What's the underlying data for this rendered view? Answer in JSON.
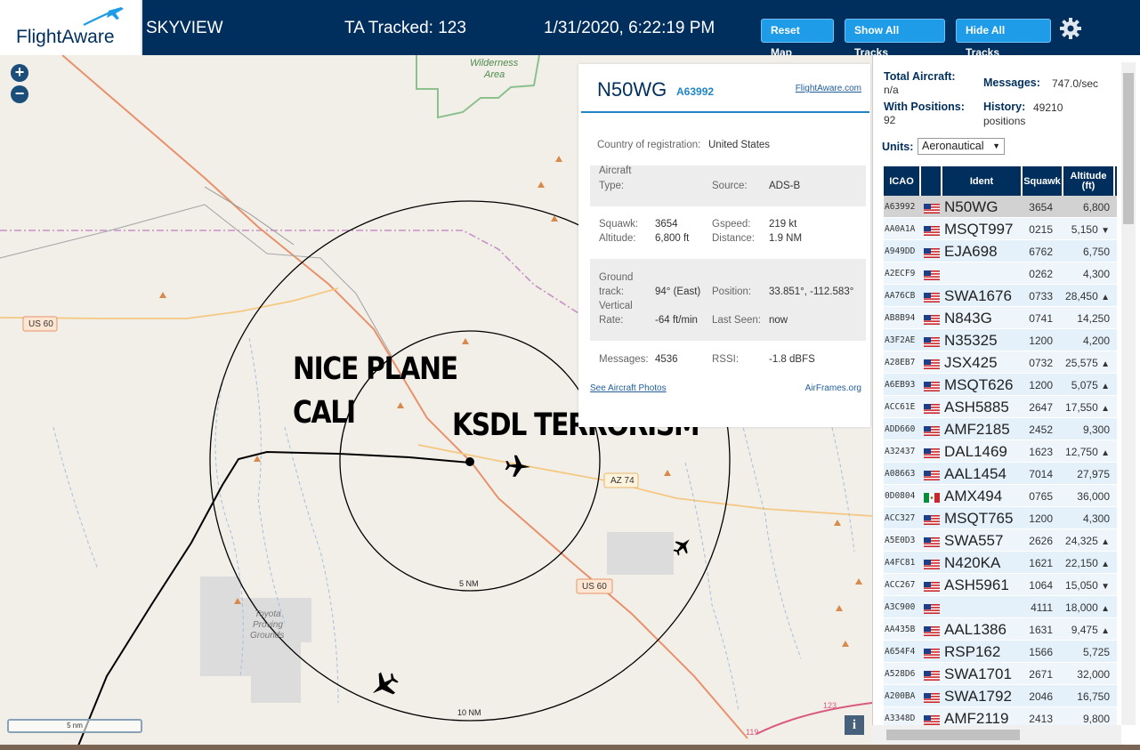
{
  "header": {
    "logo_text": "FlightAware",
    "app_name": "SKYVIEW",
    "tracked_label": "TA Tracked: 123",
    "datetime": "1/31/2020, 6:22:19 PM",
    "buttons": {
      "reset_map": "Reset Map",
      "show_all_tracks": "Show All Tracks",
      "hide_all_tracks": "Hide All Tracks"
    },
    "settings_icon": "gear-icon",
    "brand_color": "#002f5d",
    "button_color": "#1f9ce8"
  },
  "map": {
    "zoom_in": "+",
    "zoom_out": "−",
    "labels": {
      "wilderness": "Wilderness",
      "area": "Area",
      "us60_west": "US 60",
      "us60_east": "US 60",
      "az74": "AZ 74",
      "ring_5nm": "5 NM",
      "ring_10nm": "10 NM",
      "toyota_1": "Toyota",
      "toyota_2": "Proving",
      "toyota_3": "Grounds",
      "road_123": "123",
      "road_119": "119"
    },
    "overlay_text": {
      "nice_plane": "NICE PLANE",
      "cali": "CALI",
      "ksdl": "KSDL TERRORISM"
    },
    "scale_label": "5 nm",
    "info_button": "i"
  },
  "aircraft_detail": {
    "registration": "N50WG",
    "hex": "A63992",
    "flightaware_link": "FlightAware.com",
    "country_label": "Country of registration:",
    "country_value": "United States",
    "aircraft_type_label": "Aircraft",
    "aircraft_type_label2": "Type:",
    "source_label": "Source:",
    "source_value": "ADS-B",
    "squawk_label": "Squawk:",
    "squawk_value": "3654",
    "gspeed_label": "Gspeed:",
    "gspeed_value": "219 kt",
    "altitude_label": "Altitude:",
    "altitude_value": "6,800 ft",
    "distance_label": "Distance:",
    "distance_value": "1.9 NM",
    "ground_label": "Ground",
    "track_label": "track:",
    "track_value": "94° (East)",
    "position_label": "Position:",
    "position_value": "33.851°, -112.583°",
    "vertical_label": "Vertical",
    "rate_label": "Rate:",
    "rate_value": "-64 ft/min",
    "last_seen_label": "Last Seen:",
    "last_seen_value": "now",
    "messages_label": "Messages:",
    "messages_value": "4536",
    "rssi_label": "RSSI:",
    "rssi_value": "-1.8 dBFS",
    "photos_link": "See Aircraft Photos",
    "airframes_link": "AirFrames.org"
  },
  "sidebar": {
    "total_aircraft_label": "Total Aircraft:",
    "total_aircraft_value": "n/a",
    "messages_label": "Messages:",
    "messages_value": "747.0/sec",
    "with_positions_label": "With Positions:",
    "with_positions_value": "92",
    "history_label": "History:",
    "history_value": "49210",
    "history_unit": "positions",
    "units_label": "Units:",
    "units_value": "Aeronautical",
    "columns": {
      "icao": "ICAO",
      "ident": "Ident",
      "squawk": "Squawk",
      "altitude": "Altitude",
      "altitude_unit": "(ft)"
    },
    "rows": [
      {
        "icao": "A63992",
        "flag": "us",
        "ident": "N50WG",
        "squawk": "3654",
        "alt": "6,800",
        "trend": ""
      },
      {
        "icao": "AA0A1A",
        "flag": "us",
        "ident": "MSQT997",
        "squawk": "0215",
        "alt": "5,150",
        "trend": "▼"
      },
      {
        "icao": "A949DD",
        "flag": "us",
        "ident": "EJA698",
        "squawk": "6762",
        "alt": "6,750",
        "trend": ""
      },
      {
        "icao": "A2ECF9",
        "flag": "us",
        "ident": "",
        "squawk": "0262",
        "alt": "4,300",
        "trend": ""
      },
      {
        "icao": "AA76CB",
        "flag": "us",
        "ident": "SWA1676",
        "squawk": "0733",
        "alt": "28,450",
        "trend": "▲"
      },
      {
        "icao": "AB8B94",
        "flag": "us",
        "ident": "N843G",
        "squawk": "0741",
        "alt": "14,250",
        "trend": ""
      },
      {
        "icao": "A3F2AE",
        "flag": "us",
        "ident": "N35325",
        "squawk": "1200",
        "alt": "4,200",
        "trend": ""
      },
      {
        "icao": "A28EB7",
        "flag": "us",
        "ident": "JSX425",
        "squawk": "0732",
        "alt": "25,575",
        "trend": "▲"
      },
      {
        "icao": "A6EB93",
        "flag": "us",
        "ident": "MSQT626",
        "squawk": "1200",
        "alt": "5,075",
        "trend": "▲"
      },
      {
        "icao": "ACC61E",
        "flag": "us",
        "ident": "ASH5885",
        "squawk": "2647",
        "alt": "17,550",
        "trend": "▲"
      },
      {
        "icao": "ADD660",
        "flag": "us",
        "ident": "AMF2185",
        "squawk": "2452",
        "alt": "9,300",
        "trend": ""
      },
      {
        "icao": "A32437",
        "flag": "us",
        "ident": "DAL1469",
        "squawk": "1623",
        "alt": "12,750",
        "trend": "▲"
      },
      {
        "icao": "A08663",
        "flag": "us",
        "ident": "AAL1454",
        "squawk": "7014",
        "alt": "27,975",
        "trend": ""
      },
      {
        "icao": "0D0804",
        "flag": "mx",
        "ident": "AMX494",
        "squawk": "0765",
        "alt": "36,000",
        "trend": ""
      },
      {
        "icao": "ACC327",
        "flag": "us",
        "ident": "MSQT765",
        "squawk": "1200",
        "alt": "4,300",
        "trend": ""
      },
      {
        "icao": "A5E0D3",
        "flag": "us",
        "ident": "SWA557",
        "squawk": "2626",
        "alt": "24,325",
        "trend": "▲"
      },
      {
        "icao": "A4FC81",
        "flag": "us",
        "ident": "N420KA",
        "squawk": "1621",
        "alt": "22,150",
        "trend": "▲"
      },
      {
        "icao": "ACC267",
        "flag": "us",
        "ident": "ASH5961",
        "squawk": "1064",
        "alt": "15,050",
        "trend": "▼"
      },
      {
        "icao": "A3C900",
        "flag": "us",
        "ident": "",
        "squawk": "4111",
        "alt": "18,000",
        "trend": "▲"
      },
      {
        "icao": "AA435B",
        "flag": "us",
        "ident": "AAL1386",
        "squawk": "1631",
        "alt": "9,475",
        "trend": "▲"
      },
      {
        "icao": "A654F4",
        "flag": "us",
        "ident": "RSP162",
        "squawk": "1566",
        "alt": "5,725",
        "trend": ""
      },
      {
        "icao": "A528D6",
        "flag": "us",
        "ident": "SWA1701",
        "squawk": "2671",
        "alt": "32,000",
        "trend": ""
      },
      {
        "icao": "A200BA",
        "flag": "us",
        "ident": "SWA1792",
        "squawk": "2046",
        "alt": "16,750",
        "trend": ""
      },
      {
        "icao": "A3348D",
        "flag": "us",
        "ident": "AMF2119",
        "squawk": "2413",
        "alt": "9,800",
        "trend": ""
      }
    ]
  }
}
